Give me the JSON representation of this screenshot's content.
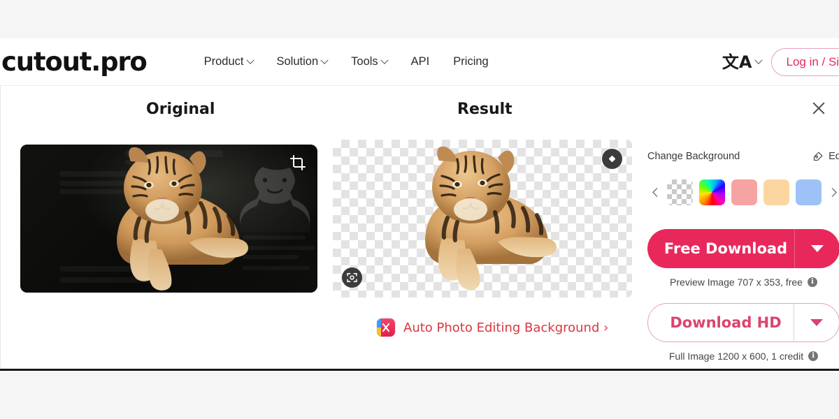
{
  "brand": {
    "logo": "cutout.pro",
    "accent": "#e8285b",
    "link_red": "#d8373f"
  },
  "header": {
    "nav": [
      {
        "label": "Product",
        "has_caret": true
      },
      {
        "label": "Solution",
        "has_caret": true
      },
      {
        "label": "Tools",
        "has_caret": true
      },
      {
        "label": "API",
        "has_caret": false
      },
      {
        "label": "Pricing",
        "has_caret": false
      }
    ],
    "language_icon": "translate-icon",
    "language_glyph": "文A",
    "login_label": "Log in / Sign"
  },
  "workspace": {
    "close_icon": "close-icon",
    "original": {
      "title": "Original",
      "crop_icon": "crop-icon"
    },
    "result": {
      "title": "Result",
      "eraser_icon": "eraser-icon",
      "focus_icon": "focus-icon"
    },
    "promo": {
      "icon": "auto-photo-editing-icon",
      "label": "Auto Photo Editing Background ›"
    }
  },
  "sidebar": {
    "change_background_label": "Change Background",
    "editor_label": "Editor",
    "editor_icon": "magic-wand-icon",
    "prev_icon": "chevron-left-icon",
    "next_icon": "chevron-right-icon",
    "swatches": [
      {
        "name": "transparent",
        "color": "transparent"
      },
      {
        "name": "rainbow",
        "color": "rainbow"
      },
      {
        "name": "pink",
        "color": "#f6a3a3"
      },
      {
        "name": "peach",
        "color": "#fbd6a1"
      },
      {
        "name": "blue",
        "color": "#9ec1f7"
      }
    ],
    "free_download": {
      "label": "Free Download",
      "caret_icon": "chevron-down-icon",
      "caption": "Preview Image 707 x 353, free",
      "info_icon": "info-icon",
      "info_glyph": "i"
    },
    "download_hd": {
      "label": "Download HD",
      "caret_icon": "chevron-down-icon",
      "caption": "Full Image 1200 x 600, 1 credit",
      "info_icon": "info-icon",
      "info_glyph": "i"
    }
  }
}
